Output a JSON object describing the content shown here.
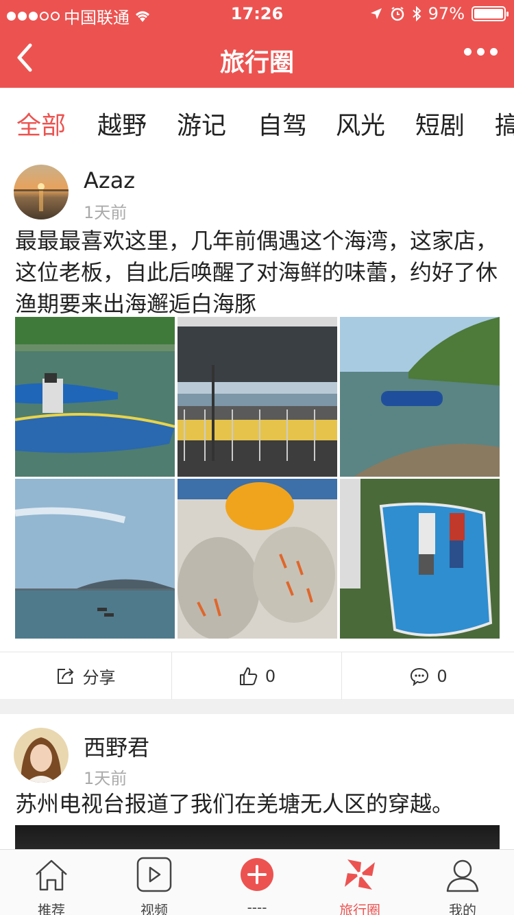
{
  "status_bar": {
    "carrier": "中国联通",
    "time": "17:26",
    "battery": "97%"
  },
  "nav": {
    "title": "旅行圈"
  },
  "categories": [
    {
      "label": "全部",
      "active": true
    },
    {
      "label": "越野"
    },
    {
      "label": "游记"
    },
    {
      "label": "自驾"
    },
    {
      "label": "风光"
    },
    {
      "label": "短剧"
    },
    {
      "label": "搞"
    }
  ],
  "posts": [
    {
      "username": "Azaz",
      "time_ago": "1天前",
      "text": "最最最喜欢这里，几年前偶遇这个海湾，这家店，这位老板，自此后唤醒了对海鲜的味蕾，约好了休渔期要来出海邂逅白海豚",
      "share_label": "分享",
      "likes": "0",
      "comments": "0"
    },
    {
      "username": "西野君",
      "time_ago": "1天前",
      "text": "苏州电视台报道了我们在羌塘无人区的穿越。"
    }
  ],
  "tabbar": [
    {
      "label": "推荐"
    },
    {
      "label": "视频"
    },
    {
      "label": "----"
    },
    {
      "label": "旅行圈",
      "active": true
    },
    {
      "label": "我的"
    }
  ],
  "colors": {
    "accent": "#ec5350"
  }
}
